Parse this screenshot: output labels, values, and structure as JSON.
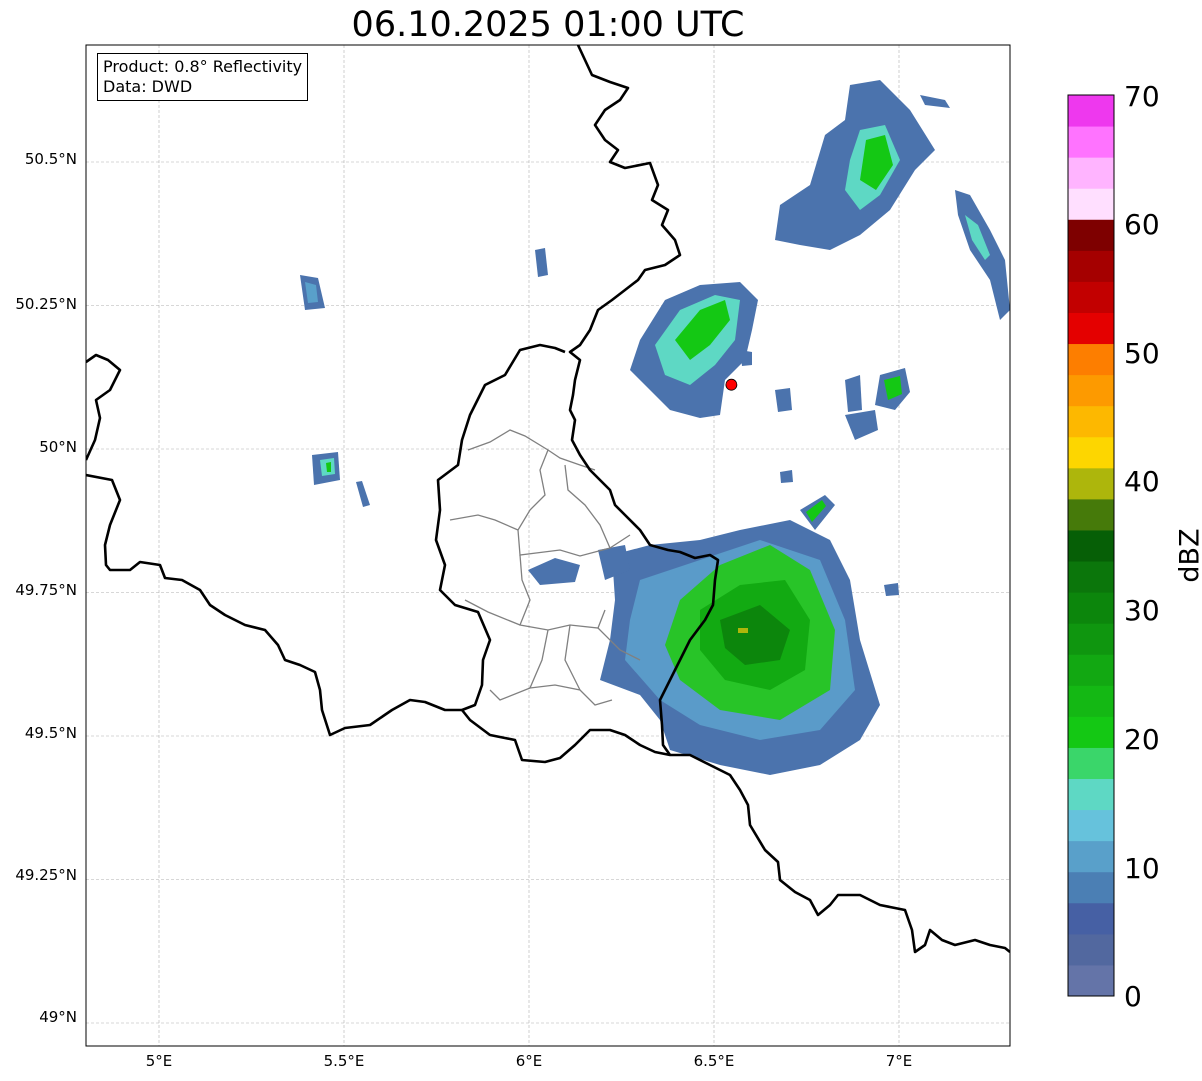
{
  "title": "06.10.2025 01:00 UTC",
  "info_box": {
    "product_line": "Product: 0.8° Reflectivity",
    "data_line": "Data: DWD"
  },
  "axes": {
    "lon_ticks": [
      "5°E",
      "5.5°E",
      "6°E",
      "6.5°E",
      "7°E"
    ],
    "lat_ticks": [
      "50.5°N",
      "50.25°N",
      "50°N",
      "49.75°N",
      "49.5°N",
      "49.25°N",
      "49°N"
    ],
    "lon_range": [
      4.8,
      7.3
    ],
    "lat_range": [
      48.95,
      50.7
    ],
    "grid": true
  },
  "colorbar": {
    "label": "dBZ",
    "ticks": [
      "0",
      "10",
      "20",
      "30",
      "40",
      "50",
      "60",
      "70"
    ],
    "range": [
      0,
      70
    ],
    "colors": [
      "#6474a8",
      "#52689f",
      "#4660a4",
      "#4b7fb4",
      "#59a0ca",
      "#66c2dc",
      "#5ed8c4",
      "#3ad66a",
      "#14c814",
      "#14b814",
      "#12a812",
      "#0f960f",
      "#0c860c",
      "#0b760b",
      "#065f06",
      "#467a0a",
      "#adb60c",
      "#fdd600",
      "#fdb800",
      "#fd9a00",
      "#fd7e00",
      "#e40000",
      "#c20000",
      "#a50000",
      "#7e0000",
      "#ffdfff",
      "#ffb4ff",
      "#ff73ff",
      "#ee38ee"
    ]
  },
  "radar_site": {
    "lon": 6.547,
    "lat": 50.112,
    "color": "#ff0000"
  },
  "colors": {
    "border": "#000000",
    "admin": "#808080",
    "grid": "#b0b0b0"
  }
}
